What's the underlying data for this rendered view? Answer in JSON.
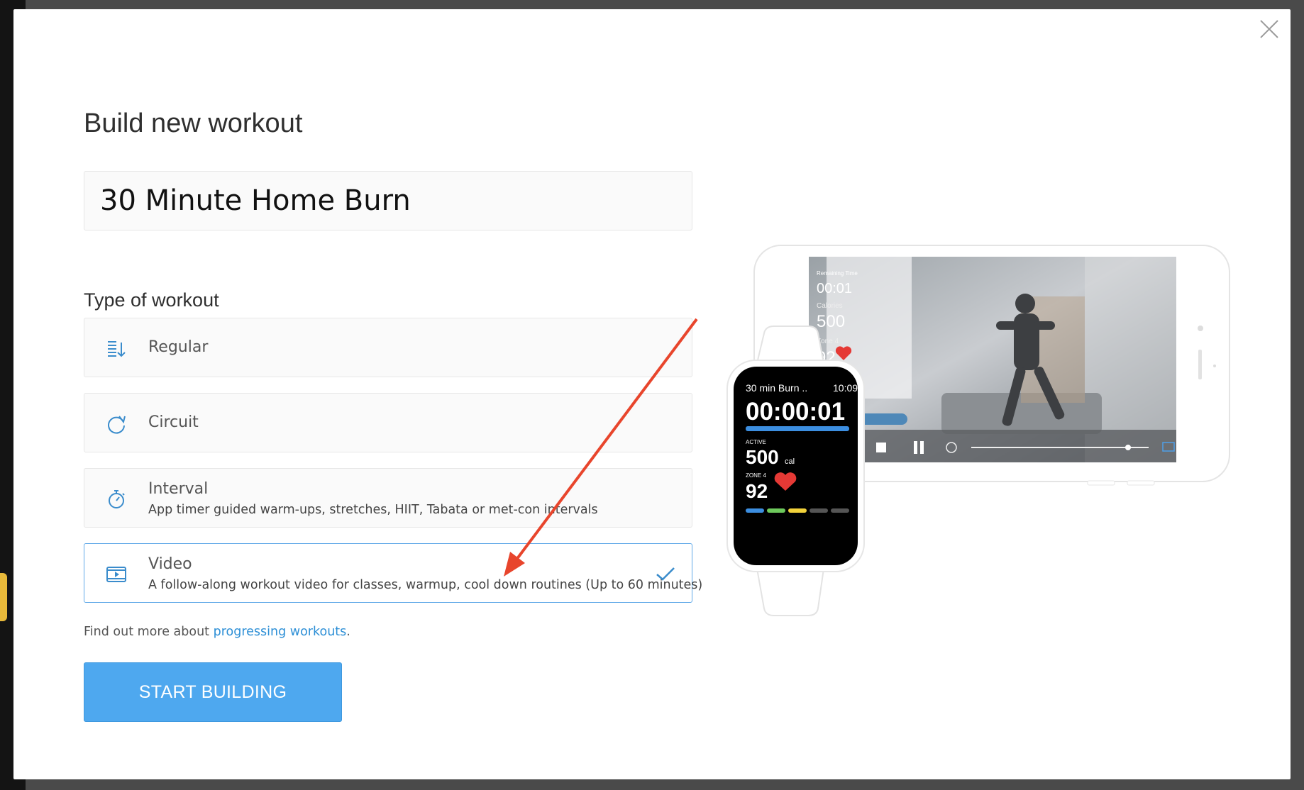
{
  "modal": {
    "title": "Build new workout",
    "name_input": {
      "value": "30 Minute Home Burn",
      "placeholder": ""
    },
    "type_heading": "Type of workout",
    "options": [
      {
        "label": "Regular",
        "description": "",
        "icon": "list-sort-icon",
        "selected": false
      },
      {
        "label": "Circuit",
        "description": "",
        "icon": "circuit-refresh-icon",
        "selected": false
      },
      {
        "label": "Interval",
        "description": "App timer guided warm-ups, stretches, HIIT, Tabata or met-con intervals",
        "icon": "stopwatch-icon",
        "selected": false
      },
      {
        "label": "Video",
        "description": "A follow-along workout video for classes, warmup, cool down routines (Up to 60 minutes)",
        "icon": "video-icon",
        "selected": true
      }
    ],
    "find_more": {
      "prefix": "Find out more about ",
      "link": "progressing workouts",
      "suffix": "."
    },
    "start_button": "START BUILDING",
    "close_icon": "close-icon"
  },
  "illustration": {
    "phone_overlay": {
      "remaining_label": "Remaining Time",
      "remaining_value": "00:01",
      "calories_label": "Calories",
      "calories_value": "500",
      "zone_label": "Zone 4",
      "zone_value": "92"
    },
    "watch": {
      "workout_name": "30 min Burn ..",
      "clock": "10:09",
      "timer": "00:00:01",
      "active_label": "ACTIVE",
      "active_value": "500",
      "active_unit": "cal",
      "zone_label": "ZONE 4",
      "zone_value": "92"
    }
  },
  "colors": {
    "accent": "#4ea8ef",
    "link": "#2d8fd6",
    "selected_border": "#5fa8e8",
    "annotation_arrow": "#e8452c",
    "heart": "#e53935"
  }
}
